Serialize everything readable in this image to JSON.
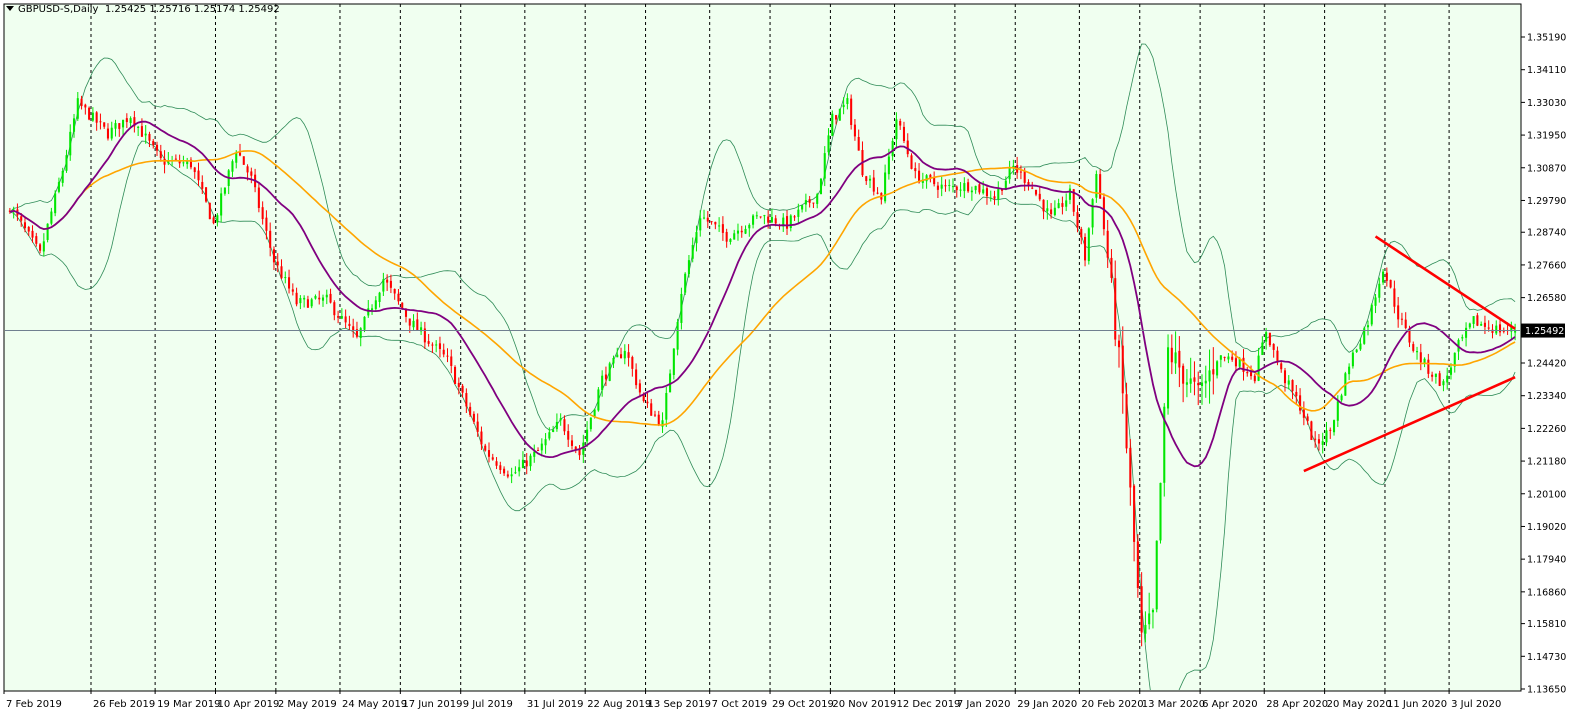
{
  "header": {
    "symbol": "GBPUSD-S,Daily",
    "ohlc": "1.25425 1.25716 1.25174 1.25492"
  },
  "colors": {
    "background": "#f0fff0",
    "frame": "#000000",
    "bull": "#00e600",
    "bear": "#ff0000",
    "ma_fast": "#800080",
    "ma_slow": "#ffa500",
    "bollinger": "#2e8b57",
    "trendline": "#ff0000",
    "price_line": "#708090",
    "grid": "#000000"
  },
  "chart_data": {
    "type": "candlestick",
    "symbol": "GBPUSD-S",
    "timeframe": "Daily",
    "last_price_label": "1.25492",
    "y_ticks": [
      1.3519,
      1.3411,
      1.3303,
      1.3195,
      1.3087,
      1.2979,
      1.2874,
      1.2766,
      1.2658,
      1.2549,
      1.2442,
      1.2334,
      1.2226,
      1.2118,
      1.201,
      1.1902,
      1.1794,
      1.1686,
      1.1581,
      1.1473,
      1.1365
    ],
    "y_tick_labels": [
      "1.35190",
      "1.34110",
      "1.33030",
      "1.31950",
      "1.30870",
      "1.29790",
      "1.28740",
      "1.27660",
      "1.26580",
      "1.25492",
      "1.24420",
      "1.23340",
      "1.22260",
      "1.21180",
      "1.20100",
      "1.19020",
      "1.17940",
      "1.16860",
      "1.15810",
      "1.14730",
      "1.13650"
    ],
    "ylim": [
      1.1365,
      1.3519
    ],
    "x_labels": [
      "7 Feb 2019",
      "26 Feb 2019",
      "19 Mar 2019",
      "10 Apr 2019",
      "2 May 2019",
      "24 May 2019",
      "17 Jun 2019",
      "9 Jul 2019",
      "31 Jul 2019",
      "22 Aug 2019",
      "13 Sep 2019",
      "7 Oct 2019",
      "29 Oct 2019",
      "20 Nov 2019",
      "12 Dec 2019",
      "7 Jan 2020",
      "29 Jan 2020",
      "20 Feb 2020",
      "13 Mar 2020",
      "6 Apr 2020",
      "28 Apr 2020",
      "20 May 2020",
      "11 Jun 2020",
      "3 Jul 2020"
    ],
    "grid": "vertical dashed",
    "series": [
      {
        "type": "candlestick"
      },
      {
        "type": "moving-average"
      },
      {
        "type": "moving-average"
      },
      {
        "type": "bollinger-bands"
      }
    ],
    "anchors": [
      {
        "i": 0,
        "p": 1.296
      },
      {
        "i": 8,
        "p": 1.28
      },
      {
        "i": 14,
        "p": 1.308
      },
      {
        "i": 18,
        "p": 1.33
      },
      {
        "i": 26,
        "p": 1.32
      },
      {
        "i": 32,
        "p": 1.326
      },
      {
        "i": 40,
        "p": 1.311
      },
      {
        "i": 48,
        "p": 1.31
      },
      {
        "i": 54,
        "p": 1.29
      },
      {
        "i": 60,
        "p": 1.315
      },
      {
        "i": 64,
        "p": 1.305
      },
      {
        "i": 70,
        "p": 1.278
      },
      {
        "i": 76,
        "p": 1.264
      },
      {
        "i": 84,
        "p": 1.265
      },
      {
        "i": 92,
        "p": 1.252
      },
      {
        "i": 99,
        "p": 1.272
      },
      {
        "i": 106,
        "p": 1.258
      },
      {
        "i": 116,
        "p": 1.245
      },
      {
        "i": 126,
        "p": 1.215
      },
      {
        "i": 133,
        "p": 1.207
      },
      {
        "i": 140,
        "p": 1.215
      },
      {
        "i": 146,
        "p": 1.225
      },
      {
        "i": 151,
        "p": 1.214
      },
      {
        "i": 157,
        "p": 1.239
      },
      {
        "i": 163,
        "p": 1.249
      },
      {
        "i": 168,
        "p": 1.231
      },
      {
        "i": 173,
        "p": 1.224
      },
      {
        "i": 178,
        "p": 1.268
      },
      {
        "i": 183,
        "p": 1.293
      },
      {
        "i": 190,
        "p": 1.286
      },
      {
        "i": 199,
        "p": 1.293
      },
      {
        "i": 206,
        "p": 1.29
      },
      {
        "i": 214,
        "p": 1.3
      },
      {
        "i": 218,
        "p": 1.325
      },
      {
        "i": 222,
        "p": 1.33
      },
      {
        "i": 226,
        "p": 1.308
      },
      {
        "i": 231,
        "p": 1.299
      },
      {
        "i": 235,
        "p": 1.325
      },
      {
        "i": 240,
        "p": 1.306
      },
      {
        "i": 248,
        "p": 1.302
      },
      {
        "i": 255,
        "p": 1.303
      },
      {
        "i": 261,
        "p": 1.299
      },
      {
        "i": 266,
        "p": 1.309
      },
      {
        "i": 270,
        "p": 1.304
      },
      {
        "i": 276,
        "p": 1.292
      },
      {
        "i": 281,
        "p": 1.3
      },
      {
        "i": 285,
        "p": 1.279
      },
      {
        "i": 288,
        "p": 1.308
      },
      {
        "i": 291,
        "p": 1.279
      },
      {
        "i": 295,
        "p": 1.233
      },
      {
        "i": 300,
        "p": 1.152
      },
      {
        "i": 303,
        "p": 1.16
      },
      {
        "i": 307,
        "p": 1.248
      },
      {
        "i": 311,
        "p": 1.241
      },
      {
        "i": 315,
        "p": 1.233
      },
      {
        "i": 320,
        "p": 1.246
      },
      {
        "i": 324,
        "p": 1.246
      },
      {
        "i": 330,
        "p": 1.24
      },
      {
        "i": 333,
        "p": 1.255
      },
      {
        "i": 337,
        "p": 1.241
      },
      {
        "i": 342,
        "p": 1.23
      },
      {
        "i": 346,
        "p": 1.217
      },
      {
        "i": 350,
        "p": 1.222
      },
      {
        "i": 355,
        "p": 1.244
      },
      {
        "i": 360,
        "p": 1.258
      },
      {
        "i": 364,
        "p": 1.276
      },
      {
        "i": 368,
        "p": 1.26
      },
      {
        "i": 372,
        "p": 1.249
      },
      {
        "i": 376,
        "p": 1.242
      },
      {
        "i": 380,
        "p": 1.237
      },
      {
        "i": 384,
        "p": 1.25
      },
      {
        "i": 388,
        "p": 1.258
      },
      {
        "i": 392,
        "p": 1.256
      },
      {
        "i": 396,
        "p": 1.2549
      }
    ],
    "trendlines": [
      {
        "from": {
          "i": 362,
          "p": 1.286
        },
        "to": {
          "i": 399,
          "p": 1.2555
        }
      },
      {
        "from": {
          "i": 343,
          "p": 1.2085
        },
        "to": {
          "i": 399,
          "p": 1.2395
        }
      }
    ]
  }
}
